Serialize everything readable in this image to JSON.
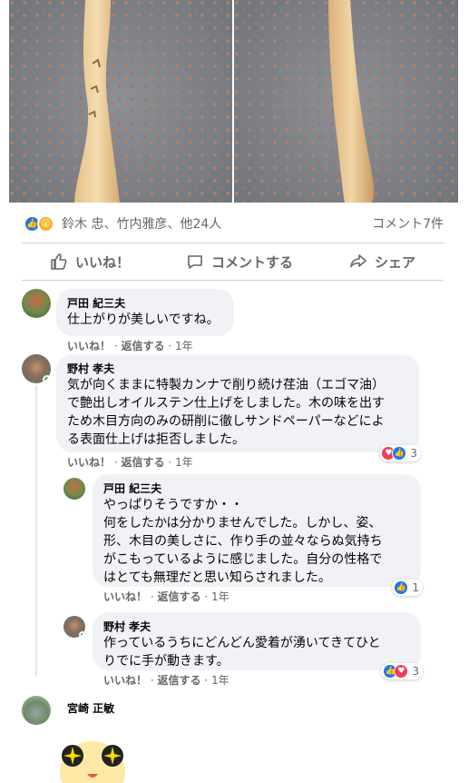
{
  "post": {
    "reactions": {
      "summary": "鈴木 忠、竹内雅彦、他24人",
      "comments_count": "コメント7件"
    },
    "actions": {
      "like": "いいね！",
      "comment": "コメントする",
      "share": "シェア"
    }
  },
  "comments": [
    {
      "author": "戸田 紀三夫",
      "text": "仕上がりが美しいですね。",
      "like": "いいね！",
      "reply": "返信する",
      "time": "1年"
    },
    {
      "author": "野村 孝夫",
      "text": "気が向くままに特製カンナで削り続け荏油（エゴマ油）で艶出しオイルステン仕上げをしました。木の味を出すため木目方向のみの研削に徹しサンドペーパーなどによる表面仕上げは拒否しました。",
      "text_lines": [
        "気が向くままに特製カンナで削り続け荏油（エゴマ油）",
        "で艶出しオイルステン仕上げをしました。木の味を出す",
        "ため木目方向のみの研削に徹しサンドペーパーなどによ",
        "る表面仕上げは拒否しました。"
      ],
      "like": "いいね！",
      "reply": "返信する",
      "time": "1年",
      "reactions": "3",
      "replies": [
        {
          "author": "戸田 紀三夫",
          "text_lines": [
            "やっぱりそうですか・・",
            "何をしたかは分かりませんでした。しかし、姿、",
            "形、木目の美しさに、作り手の並々ならぬ気持ち",
            "がこもっているように感じました。自分の性格で",
            "はとても無理だと思い知らされました。"
          ],
          "like": "いいね！",
          "reply": "返信する",
          "time": "1年",
          "reactions": "1"
        },
        {
          "author": "野村 孝夫",
          "text_lines": [
            "作っているうちにどんどん愛着が湧いてきてひと",
            "りでに手が動きます。"
          ],
          "like": "いいね！",
          "reply": "返信する",
          "time": "1年",
          "reactions": "3"
        }
      ]
    },
    {
      "author": "宮崎 正敏"
    }
  ],
  "colors": {
    "accent": "#1877f2",
    "love": "#f33e58",
    "bubble": "#f0f2f5",
    "secondary_text": "#65676b"
  }
}
